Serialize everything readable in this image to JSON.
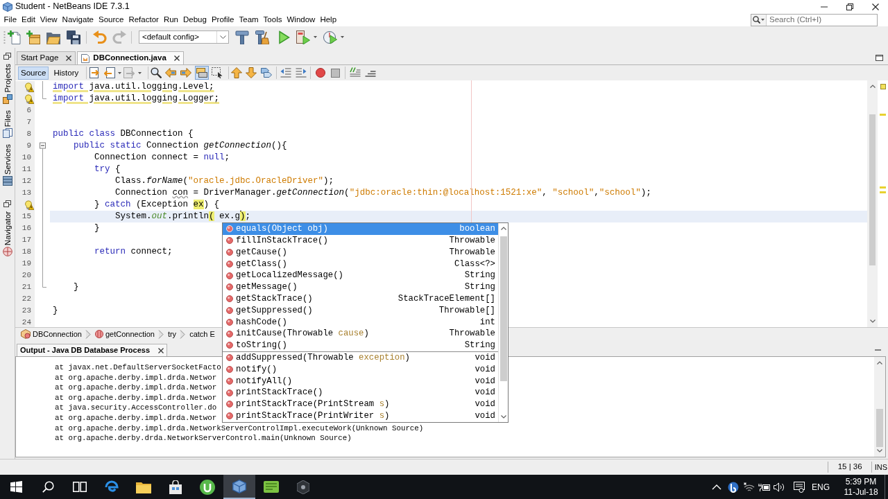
{
  "window": {
    "title": "Student - NetBeans IDE 7.3.1"
  },
  "menu": [
    "File",
    "Edit",
    "View",
    "Navigate",
    "Source",
    "Refactor",
    "Run",
    "Debug",
    "Profile",
    "Team",
    "Tools",
    "Window",
    "Help"
  ],
  "search": {
    "placeholder": "Search (Ctrl+I)"
  },
  "toolbar": {
    "configuration": "<default config>"
  },
  "side_panels": [
    {
      "tabs": [
        {
          "kind": "projects",
          "label": "Projects"
        },
        {
          "kind": "files",
          "label": "Files"
        },
        {
          "kind": "services",
          "label": "Services"
        }
      ]
    },
    {
      "tabs": [
        {
          "kind": "navigator",
          "label": "Navigator"
        }
      ]
    }
  ],
  "editor_tabs": [
    {
      "kind": "page",
      "label": "Start Page",
      "selected": false
    },
    {
      "kind": "java",
      "label": "DBConnection.java",
      "selected": true
    }
  ],
  "editor_toolbar": {
    "views": [
      {
        "label": "Source",
        "selected": true
      },
      {
        "label": "History",
        "selected": false
      }
    ],
    "highlight_search": {
      "pressed": true
    }
  },
  "code_lines": [
    {
      "markers": [
        {
          "kind": "hint"
        },
        {
          "kind": "guide"
        }
      ],
      "warning": true,
      "current": false,
      "tokens": [
        {
          "kind": "keyword",
          "text": "import"
        },
        {
          "kind": "plain",
          "text": " java.util.logging.Level;"
        }
      ]
    },
    {
      "markers": [
        {
          "kind": "hint"
        },
        {
          "kind": "corner"
        }
      ],
      "warning": true,
      "current": false,
      "tokens": [
        {
          "kind": "keyword",
          "text": "import"
        },
        {
          "kind": "plain",
          "text": " java.util.logging.Logger;"
        }
      ]
    },
    {
      "number": "6",
      "warning": false,
      "current": false
    },
    {
      "number": "7",
      "warning": false,
      "current": false
    },
    {
      "number": "8",
      "warning": false,
      "current": false,
      "tokens": [
        {
          "kind": "keyword",
          "text": "public class"
        },
        {
          "kind": "plain",
          "text": " DBConnection {"
        }
      ]
    },
    {
      "number": "9",
      "markers": [
        {
          "kind": "collapse"
        }
      ],
      "warning": false,
      "current": false,
      "tokens": [
        {
          "kind": "keyword",
          "text": "    public static"
        },
        {
          "kind": "plain",
          "text": " Connection "
        },
        {
          "kind": "method",
          "text": "getConnection"
        },
        {
          "kind": "plain",
          "text": "(){"
        }
      ]
    },
    {
      "number": "10",
      "markers": [
        {
          "kind": "guide"
        }
      ],
      "warning": false,
      "current": false,
      "tokens": [
        {
          "kind": "plain",
          "text": "        Connection connect = "
        },
        {
          "kind": "keyword",
          "text": "null"
        },
        {
          "kind": "plain",
          "text": ";"
        }
      ]
    },
    {
      "number": "11",
      "markers": [
        {
          "kind": "guide"
        }
      ],
      "warning": false,
      "current": false,
      "tokens": [
        {
          "kind": "keyword",
          "text": "        try"
        },
        {
          "kind": "plain",
          "text": " {"
        }
      ]
    },
    {
      "number": "12",
      "markers": [
        {
          "kind": "guide"
        }
      ],
      "warning": false,
      "current": false,
      "tokens": [
        {
          "kind": "plain",
          "text": "            Class."
        },
        {
          "kind": "method",
          "text": "forName"
        },
        {
          "kind": "plain",
          "text": "("
        },
        {
          "kind": "string",
          "text": "\"oracle.jdbc.OracleDriver\""
        },
        {
          "kind": "plain",
          "text": ");"
        }
      ]
    },
    {
      "number": "13",
      "markers": [
        {
          "kind": "guide"
        }
      ],
      "warning": false,
      "current": false,
      "tokens": [
        {
          "kind": "plain",
          "text": "            Connection "
        },
        {
          "kind": "unused",
          "text": "con"
        },
        {
          "kind": "plain",
          "text": " = DriverManager."
        },
        {
          "kind": "method",
          "text": "getConnection"
        },
        {
          "kind": "plain",
          "text": "("
        },
        {
          "kind": "string",
          "text": "\"jdbc:oracle:thin:@localhost:1521:xe\""
        },
        {
          "kind": "plain",
          "text": ", "
        },
        {
          "kind": "string",
          "text": "\"school\""
        },
        {
          "kind": "plain",
          "text": ","
        },
        {
          "kind": "string",
          "text": "\"school\""
        },
        {
          "kind": "plain",
          "text": ");"
        }
      ]
    },
    {
      "markers": [
        {
          "kind": "hint"
        },
        {
          "kind": "guide"
        }
      ],
      "warning": false,
      "current": false,
      "tokens": [
        {
          "kind": "plain",
          "text": "        } "
        },
        {
          "kind": "keyword",
          "text": "catch"
        },
        {
          "kind": "plain",
          "text": " (Exception "
        },
        {
          "kind": "match",
          "text": "ex"
        },
        {
          "kind": "plain",
          "text": ") {"
        }
      ]
    },
    {
      "number": "15",
      "markers": [
        {
          "kind": "guide"
        }
      ],
      "warning": false,
      "current": true,
      "tokens": [
        {
          "kind": "plain",
          "text": "            System."
        },
        {
          "kind": "field",
          "text": "out"
        },
        {
          "kind": "plain",
          "text": ".println"
        },
        {
          "kind": "match",
          "text": "("
        },
        {
          "kind": "plain",
          "text": " ex.g"
        },
        {
          "kind": "caret"
        },
        {
          "kind": "match",
          "text": ")"
        },
        {
          "kind": "plain",
          "text": ";"
        }
      ]
    },
    {
      "number": "16",
      "markers": [
        {
          "kind": "guide"
        }
      ],
      "warning": false,
      "current": false,
      "tokens": [
        {
          "kind": "plain",
          "text": "        }"
        }
      ]
    },
    {
      "number": "17",
      "markers": [
        {
          "kind": "guide"
        }
      ],
      "warning": false,
      "current": false
    },
    {
      "number": "18",
      "markers": [
        {
          "kind": "guide"
        }
      ],
      "warning": false,
      "current": false,
      "tokens": [
        {
          "kind": "keyword",
          "text": "        return"
        },
        {
          "kind": "plain",
          "text": " connect;"
        }
      ]
    },
    {
      "number": "19",
      "markers": [
        {
          "kind": "guide"
        }
      ],
      "warning": false,
      "current": false
    },
    {
      "number": "20",
      "markers": [
        {
          "kind": "guide"
        }
      ],
      "warning": false,
      "current": false
    },
    {
      "number": "21",
      "markers": [
        {
          "kind": "corner"
        }
      ],
      "warning": false,
      "current": false,
      "tokens": [
        {
          "kind": "plain",
          "text": "    }"
        }
      ]
    },
    {
      "number": "22",
      "warning": false,
      "current": false
    },
    {
      "number": "23",
      "warning": false,
      "current": false,
      "tokens": [
        {
          "kind": "plain",
          "text": "}"
        }
      ]
    },
    {
      "number": "24",
      "warning": false,
      "current": false
    }
  ],
  "completion": {
    "groups": [
      {
        "items": [
          {
            "signature": [
              {
                "kind": "text",
                "text": "equals(Object "
              },
              {
                "kind": "param",
                "text": "obj"
              },
              {
                "kind": "text",
                "text": ")"
              }
            ],
            "type": "boolean",
            "selected": true
          },
          {
            "signature": [
              {
                "kind": "text",
                "text": "fillInStackTrace()"
              }
            ],
            "type": "Throwable",
            "selected": false
          },
          {
            "signature": [
              {
                "kind": "text",
                "text": "getCause()"
              }
            ],
            "type": "Throwable",
            "selected": false
          },
          {
            "signature": [
              {
                "kind": "text",
                "text": "getClass()"
              }
            ],
            "type": "Class<?>",
            "selected": false
          },
          {
            "signature": [
              {
                "kind": "text",
                "text": "getLocalizedMessage()"
              }
            ],
            "type": "String",
            "selected": false
          },
          {
            "signature": [
              {
                "kind": "text",
                "text": "getMessage()"
              }
            ],
            "type": "String",
            "selected": false
          },
          {
            "signature": [
              {
                "kind": "text",
                "text": "getStackTrace()"
              }
            ],
            "type": "StackTraceElement[]",
            "selected": false
          },
          {
            "signature": [
              {
                "kind": "text",
                "text": "getSuppressed()"
              }
            ],
            "type": "Throwable[]",
            "selected": false
          },
          {
            "signature": [
              {
                "kind": "text",
                "text": "hashCode()"
              }
            ],
            "type": "int",
            "selected": false
          },
          {
            "signature": [
              {
                "kind": "text",
                "text": "initCause(Throwable "
              },
              {
                "kind": "param",
                "text": "cause"
              },
              {
                "kind": "text",
                "text": ")"
              }
            ],
            "type": "Throwable",
            "selected": false
          },
          {
            "signature": [
              {
                "kind": "text",
                "text": "toString()"
              }
            ],
            "type": "String",
            "selected": false
          }
        ]
      },
      {
        "items": [
          {
            "signature": [
              {
                "kind": "text",
                "text": "addSuppressed(Throwable "
              },
              {
                "kind": "param",
                "text": "exception"
              },
              {
                "kind": "text",
                "text": ")"
              }
            ],
            "type": "void",
            "selected": false
          },
          {
            "signature": [
              {
                "kind": "text",
                "text": "notify()"
              }
            ],
            "type": "void",
            "selected": false
          },
          {
            "signature": [
              {
                "kind": "text",
                "text": "notifyAll()"
              }
            ],
            "type": "void",
            "selected": false
          },
          {
            "signature": [
              {
                "kind": "text",
                "text": "printStackTrace()"
              }
            ],
            "type": "void",
            "selected": false
          },
          {
            "signature": [
              {
                "kind": "text",
                "text": "printStackTrace(PrintStream "
              },
              {
                "kind": "param",
                "text": "s"
              },
              {
                "kind": "text",
                "text": ")"
              }
            ],
            "type": "void",
            "selected": false
          },
          {
            "signature": [
              {
                "kind": "text",
                "text": "printStackTrace(PrintWriter "
              },
              {
                "kind": "param",
                "text": "s"
              },
              {
                "kind": "text",
                "text": ")"
              }
            ],
            "type": "void",
            "selected": false
          }
        ]
      }
    ]
  },
  "breadcrumbs": [
    {
      "kind": "class",
      "label": "DBConnection"
    },
    {
      "kind": "method",
      "label": "getConnection"
    },
    {
      "kind": "block",
      "label": "try"
    },
    {
      "kind": "block",
      "label": "catch E"
    }
  ],
  "output": {
    "title": "Output - Java DB Database Process",
    "lines": [
      "at javax.net.DefaultServerSocketFacto",
      "at org.apache.derby.impl.drda.Networ",
      "at org.apache.derby.impl.drda.Networ",
      "at org.apache.derby.impl.drda.Networ",
      "at java.security.AccessController.do",
      "at org.apache.derby.impl.drda.Networ",
      "at org.apache.derby.impl.drda.NetworkServerControlImpl.executeWork(Unknown Source)",
      "at org.apache.derby.drda.NetworkServerControl.main(Unknown Source)"
    ]
  },
  "status_bar": {
    "position": "15 | 36",
    "mode": "INS"
  },
  "taskbar": {
    "apps": [
      {
        "kind": "start",
        "selected": false
      },
      {
        "kind": "search",
        "selected": false
      },
      {
        "kind": "taskview",
        "selected": false
      },
      {
        "kind": "browser",
        "selected": false
      },
      {
        "kind": "folder",
        "selected": false
      },
      {
        "kind": "store",
        "selected": false
      },
      {
        "kind": "round",
        "selected": false
      },
      {
        "kind": "ide",
        "selected": true
      },
      {
        "kind": "tile",
        "selected": false
      },
      {
        "kind": "tool",
        "selected": false
      }
    ],
    "language": "ENG",
    "time": "5:39 PM",
    "date": "11-Jul-18"
  }
}
